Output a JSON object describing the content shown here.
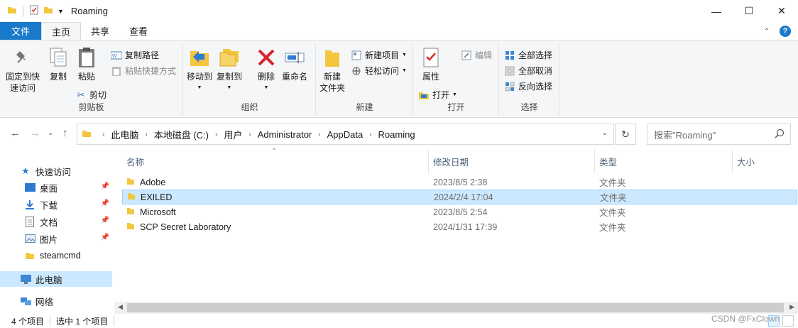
{
  "window": {
    "title": "Roaming",
    "controls": {
      "minimize": "—",
      "maximize": "☐",
      "close": "✕"
    }
  },
  "ribbon_tabs": [
    "文件",
    "主页",
    "共享",
    "查看"
  ],
  "ribbon": {
    "clipboard": {
      "pin_label": [
        "固定到快",
        "速访问"
      ],
      "copy": "复制",
      "paste": "粘贴",
      "copy_path": "复制路径",
      "paste_shortcut": "粘贴快捷方式",
      "cut": "剪切",
      "group": "剪贴板"
    },
    "organize": {
      "move_to": "移动到",
      "copy_to": "复制到",
      "delete": "删除",
      "rename": "重命名",
      "group": "组织"
    },
    "new": {
      "new_folder": [
        "新建",
        "文件夹"
      ],
      "new_item": "新建项目",
      "easy_access": "轻松访问",
      "group": "新建"
    },
    "open": {
      "properties": "属性",
      "open": "打开",
      "edit": "编辑",
      "group": "打开"
    },
    "select": {
      "select_all": "全部选择",
      "select_none": "全部取消",
      "invert": "反向选择",
      "group": "选择"
    }
  },
  "breadcrumb": [
    "此电脑",
    "本地磁盘 (C:)",
    "用户",
    "Administrator",
    "AppData",
    "Roaming"
  ],
  "search": {
    "placeholder": "搜索\"Roaming\""
  },
  "navpane": {
    "quick_access": "快速访问",
    "items": [
      {
        "label": "桌面",
        "icon": "desktop-icon",
        "pinned": true
      },
      {
        "label": "下载",
        "icon": "download-icon",
        "pinned": true
      },
      {
        "label": "文档",
        "icon": "document-icon",
        "pinned": true
      },
      {
        "label": "图片",
        "icon": "picture-icon",
        "pinned": true
      },
      {
        "label": "steamcmd",
        "icon": "folder-icon",
        "pinned": false
      }
    ],
    "this_pc": "此电脑",
    "network": "网络"
  },
  "columns": {
    "name": "名称",
    "modified": "修改日期",
    "type": "类型",
    "size": "大小"
  },
  "files": [
    {
      "name": "Adobe",
      "modified": "2023/8/5 2:38",
      "type": "文件夹",
      "selected": false
    },
    {
      "name": "EXILED",
      "modified": "2024/2/4 17:04",
      "type": "文件夹",
      "selected": true
    },
    {
      "name": "Microsoft",
      "modified": "2023/8/5 2:54",
      "type": "文件夹",
      "selected": false
    },
    {
      "name": "SCP Secret Laboratory",
      "modified": "2024/1/31 17:39",
      "type": "文件夹",
      "selected": false
    }
  ],
  "status": {
    "item_count": "4 个项目",
    "selected_count": "选中 1 个项目"
  },
  "watermark": "CSDN @FxClown",
  "colors": {
    "accent": "#1979ca",
    "selection": "#cce8ff",
    "folder": "#f3c63e"
  }
}
